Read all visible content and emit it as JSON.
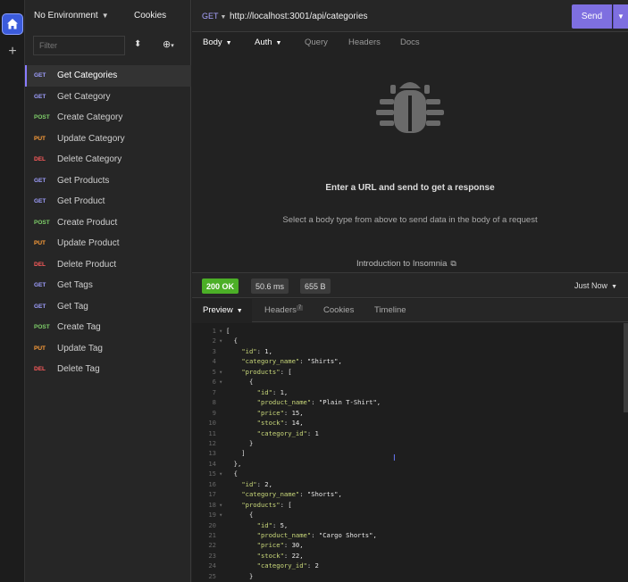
{
  "rail": {
    "home_icon": "home-icon",
    "add_icon": "plus-icon"
  },
  "sidebar": {
    "environment": "No Environment",
    "cookies": "Cookies",
    "filter_placeholder": "Filter",
    "requests": [
      {
        "method": "GET",
        "label": "Get Categories",
        "active": true
      },
      {
        "method": "GET",
        "label": "Get Category"
      },
      {
        "method": "POST",
        "label": "Create Category"
      },
      {
        "method": "PUT",
        "label": "Update Category"
      },
      {
        "method": "DEL",
        "label": "Delete Category"
      },
      {
        "method": "GET",
        "label": "Get Products"
      },
      {
        "method": "GET",
        "label": "Get Product"
      },
      {
        "method": "POST",
        "label": "Create Product"
      },
      {
        "method": "PUT",
        "label": "Update Product"
      },
      {
        "method": "DEL",
        "label": "Delete Product"
      },
      {
        "method": "GET",
        "label": "Get Tags"
      },
      {
        "method": "GET",
        "label": "Get Tag"
      },
      {
        "method": "POST",
        "label": "Create Tag"
      },
      {
        "method": "PUT",
        "label": "Update Tag"
      },
      {
        "method": "DEL",
        "label": "Delete Tag"
      }
    ]
  },
  "urlbar": {
    "method": "GET",
    "url": "http://localhost:3001/api/categories",
    "send_label": "Send"
  },
  "request_tabs": {
    "body": "Body",
    "auth": "Auth",
    "query": "Query",
    "headers": "Headers",
    "docs": "Docs"
  },
  "request_body": {
    "hint_main": "Enter a URL and send to get a response",
    "hint_sub": "Select a body type from above to send data in the body of a request",
    "intro_link": "Introduction to Insomnia"
  },
  "response": {
    "status": "200 OK",
    "time": "50.6 ms",
    "size": "655 B",
    "timestamp": "Just Now",
    "tabs": {
      "preview": "Preview",
      "headers": "Headers",
      "headers_count": "7",
      "cookies": "Cookies",
      "timeline": "Timeline"
    },
    "code_lines": [
      {
        "n": "1",
        "fold": "▾",
        "text": "["
      },
      {
        "n": "2",
        "fold": "▾",
        "text": "  {"
      },
      {
        "n": "3",
        "fold": "",
        "key": "\"id\"",
        "val": " 1,",
        "indent": "    "
      },
      {
        "n": "4",
        "fold": "",
        "key": "\"category_name\"",
        "val": " \"Shirts\",",
        "indent": "    "
      },
      {
        "n": "5",
        "fold": "▾",
        "key": "\"products\"",
        "val": " [",
        "indent": "    "
      },
      {
        "n": "6",
        "fold": "▾",
        "text": "      {"
      },
      {
        "n": "7",
        "fold": "",
        "key": "\"id\"",
        "val": " 1,",
        "indent": "        "
      },
      {
        "n": "8",
        "fold": "",
        "key": "\"product_name\"",
        "val": " \"Plain T-Shirt\",",
        "indent": "        "
      },
      {
        "n": "9",
        "fold": "",
        "key": "\"price\"",
        "val": " 15,",
        "indent": "        "
      },
      {
        "n": "10",
        "fold": "",
        "key": "\"stock\"",
        "val": " 14,",
        "indent": "        "
      },
      {
        "n": "11",
        "fold": "",
        "key": "\"category_id\"",
        "val": " 1",
        "indent": "        "
      },
      {
        "n": "12",
        "fold": "",
        "text": "      }"
      },
      {
        "n": "13",
        "fold": "",
        "text": "    ]"
      },
      {
        "n": "14",
        "fold": "",
        "text": "  },"
      },
      {
        "n": "15",
        "fold": "▾",
        "text": "  {"
      },
      {
        "n": "16",
        "fold": "",
        "key": "\"id\"",
        "val": " 2,",
        "indent": "    "
      },
      {
        "n": "17",
        "fold": "",
        "key": "\"category_name\"",
        "val": " \"Shorts\",",
        "indent": "    "
      },
      {
        "n": "18",
        "fold": "▾",
        "key": "\"products\"",
        "val": " [",
        "indent": "    "
      },
      {
        "n": "19",
        "fold": "▾",
        "text": "      {"
      },
      {
        "n": "20",
        "fold": "",
        "key": "\"id\"",
        "val": " 5,",
        "indent": "        "
      },
      {
        "n": "21",
        "fold": "",
        "key": "\"product_name\"",
        "val": " \"Cargo Shorts\",",
        "indent": "        "
      },
      {
        "n": "22",
        "fold": "",
        "key": "\"price\"",
        "val": " 30,",
        "indent": "        "
      },
      {
        "n": "23",
        "fold": "",
        "key": "\"stock\"",
        "val": " 22,",
        "indent": "        "
      },
      {
        "n": "24",
        "fold": "",
        "key": "\"category_id\"",
        "val": " 2",
        "indent": "        "
      },
      {
        "n": "25",
        "fold": "",
        "text": "      }"
      }
    ]
  },
  "colors": {
    "accent": "#7e6fe0",
    "ok": "#4caf27",
    "get": "#9f9fff",
    "post": "#7fd06a",
    "put": "#ff9f3a",
    "del": "#ff5c5c"
  }
}
